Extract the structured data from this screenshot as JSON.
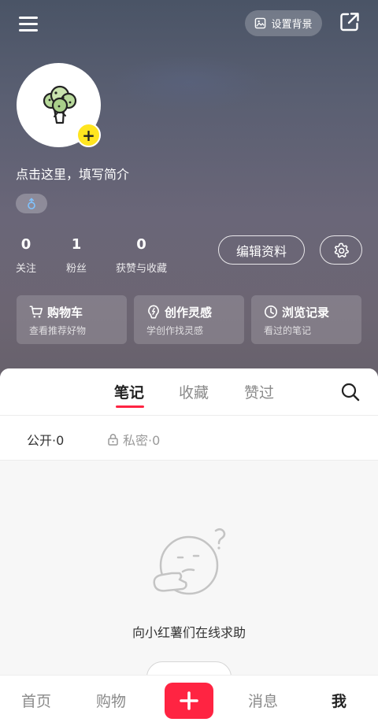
{
  "header": {
    "set_background_label": "设置背景",
    "bio_prompt": "点击这里，填写简介",
    "gender_icon": "male-symbol-icon",
    "stats": [
      {
        "value": "0",
        "label": "关注"
      },
      {
        "value": "1",
        "label": "粉丝"
      },
      {
        "value": "0",
        "label": "获赞与收藏"
      }
    ],
    "edit_profile_label": "编辑资料",
    "cards": [
      {
        "title": "购物车",
        "subtitle": "查看推荐好物",
        "icon": "cart-icon"
      },
      {
        "title": "创作灵感",
        "subtitle": "学创作找灵感",
        "icon": "lightbulb-icon"
      },
      {
        "title": "浏览记录",
        "subtitle": "看过的笔记",
        "icon": "clock-icon"
      }
    ]
  },
  "content": {
    "tabs": [
      {
        "label": "笔记",
        "active": true
      },
      {
        "label": "收藏",
        "active": false
      },
      {
        "label": "赞过",
        "active": false
      }
    ],
    "subtabs": {
      "public": "公开·0",
      "private": "私密·0"
    },
    "empty_text": "向小红薯们在线求助"
  },
  "bottom_nav": {
    "items": [
      {
        "label": "首页",
        "active": false
      },
      {
        "label": "购物",
        "active": false
      },
      {
        "label": "消息",
        "active": false
      },
      {
        "label": "我",
        "active": true
      }
    ]
  },
  "colors": {
    "accent": "#ff2442",
    "avatar_badge": "#ffe51f"
  }
}
